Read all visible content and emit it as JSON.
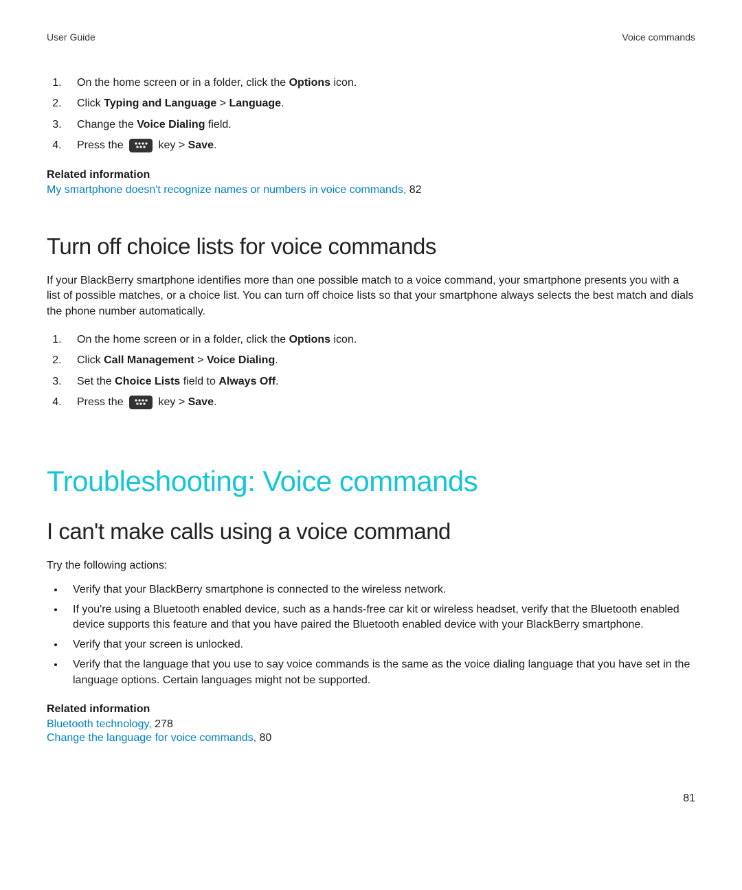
{
  "header": {
    "left": "User Guide",
    "right": "Voice commands"
  },
  "topSteps": [
    {
      "pre": "On the home screen or in a folder, click the ",
      "b1": "Options",
      "mid1": " icon.",
      "b2": "",
      "mid2": "",
      "b3": "",
      "end": "",
      "hasKey": false
    },
    {
      "pre": "Click ",
      "b1": "Typing and Language",
      "mid1": " > ",
      "b2": "Language",
      "mid2": ".",
      "b3": "",
      "end": "",
      "hasKey": false
    },
    {
      "pre": "Change the ",
      "b1": "Voice Dialing",
      "mid1": " field.",
      "b2": "",
      "mid2": "",
      "b3": "",
      "end": "",
      "hasKey": false
    },
    {
      "pre": "Press the ",
      "b1": "",
      "mid1": " key > ",
      "b2": "Save",
      "mid2": ".",
      "b3": "",
      "end": "",
      "hasKey": true
    }
  ],
  "related1": {
    "heading": "Related information",
    "link": "My smartphone doesn't recognize names or numbers in voice commands,",
    "page": " 82"
  },
  "section1": {
    "heading": "Turn off choice lists for voice commands",
    "para": "If your BlackBerry smartphone identifies more than one possible match to a voice command, your smartphone presents you with a list of possible matches, or a choice list. You can turn off choice lists so that your smartphone always selects the best match and dials the phone number automatically."
  },
  "midSteps": [
    {
      "pre": "On the home screen or in a folder, click the ",
      "b1": "Options",
      "mid1": " icon.",
      "b2": "",
      "mid2": "",
      "b3": "",
      "end": "",
      "hasKey": false
    },
    {
      "pre": "Click ",
      "b1": "Call Management",
      "mid1": " > ",
      "b2": "Voice Dialing",
      "mid2": ".",
      "b3": "",
      "end": "",
      "hasKey": false
    },
    {
      "pre": "Set the ",
      "b1": "Choice Lists",
      "mid1": " field to ",
      "b2": "Always Off",
      "mid2": ".",
      "b3": "",
      "end": "",
      "hasKey": false
    },
    {
      "pre": "Press the ",
      "b1": "",
      "mid1": " key > ",
      "b2": "Save",
      "mid2": ".",
      "b3": "",
      "end": "",
      "hasKey": true
    }
  ],
  "chapter": {
    "heading": "Troubleshooting: Voice commands"
  },
  "section2": {
    "heading": "I can't make calls using a voice command",
    "lead": "Try the following actions:",
    "bullets": [
      "Verify that your BlackBerry smartphone is connected to the wireless network.",
      "If you're using a Bluetooth enabled device, such as a hands-free car kit or wireless headset, verify that the Bluetooth enabled device supports this feature and that you have paired the Bluetooth enabled device with your BlackBerry smartphone.",
      "Verify that your screen is unlocked.",
      "Verify that the language that you use to say voice commands is the same as the voice dialing language that you have set in the language options. Certain languages might not be supported."
    ]
  },
  "related2": {
    "heading": "Related information",
    "links": [
      {
        "text": "Bluetooth technology,",
        "page": " 278"
      },
      {
        "text": "Change the language for voice commands,",
        "page": " 80"
      }
    ]
  },
  "pageNumber": "81"
}
